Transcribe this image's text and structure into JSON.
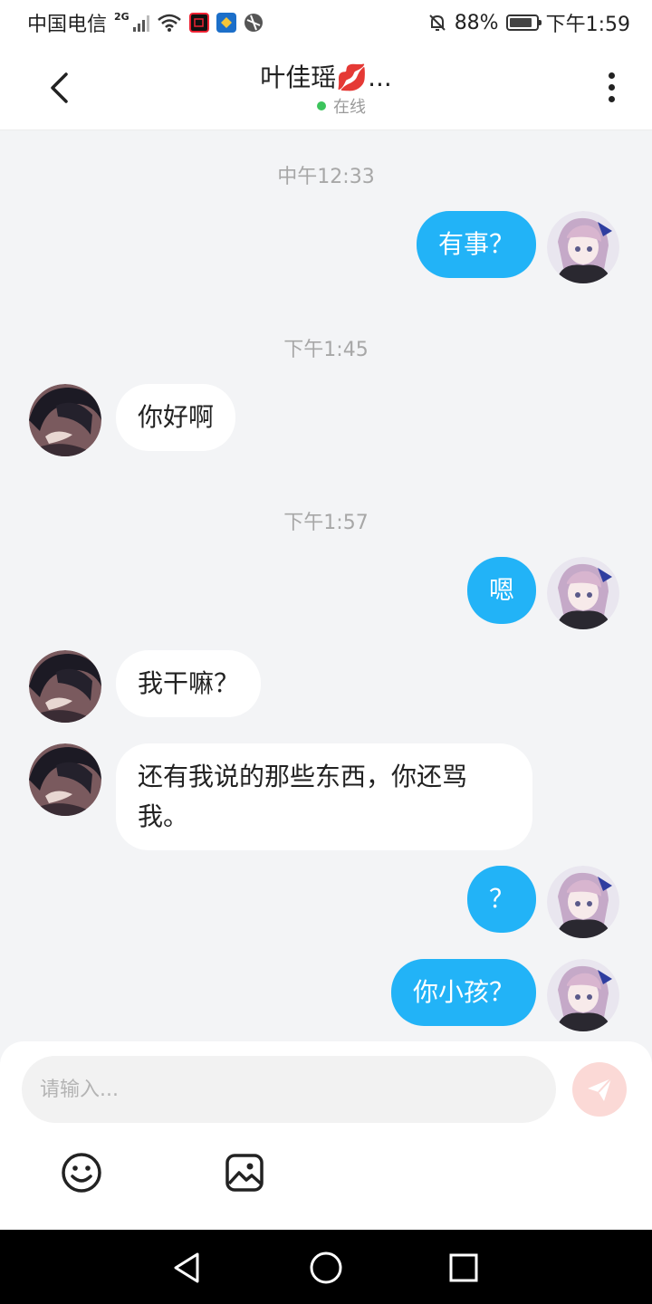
{
  "status_bar": {
    "carrier": "中国电信",
    "network_type": "2G",
    "battery_percent": "88%",
    "time": "下午1:59"
  },
  "header": {
    "title": "叶佳瑶💋...",
    "presence": "在线",
    "presence_color": "#3cc45c"
  },
  "messages": [
    {
      "type": "time",
      "text": "中午12:33"
    },
    {
      "type": "message",
      "side": "mine",
      "text": "有事？"
    },
    {
      "type": "time",
      "text": "下午1:45"
    },
    {
      "type": "message",
      "side": "theirs",
      "text": "你好啊"
    },
    {
      "type": "time",
      "text": "下午1:57"
    },
    {
      "type": "message",
      "side": "mine",
      "text": "嗯"
    },
    {
      "type": "message",
      "side": "theirs",
      "text": "我干嘛？"
    },
    {
      "type": "message",
      "side": "theirs",
      "text": "还有我说的那些东西，你还骂我。"
    },
    {
      "type": "message",
      "side": "mine",
      "text": "？"
    },
    {
      "type": "message",
      "side": "mine",
      "text": "你小孩？"
    }
  ],
  "composer": {
    "placeholder": "请输入...",
    "send_icon": "paper-plane-icon",
    "tools": [
      "emoji-icon",
      "image-icon"
    ]
  },
  "colors": {
    "mine_bubble": "#22b3f7",
    "theirs_bubble": "#ffffff",
    "background": "#f3f4f6",
    "send_button": "#fbd9d6"
  }
}
